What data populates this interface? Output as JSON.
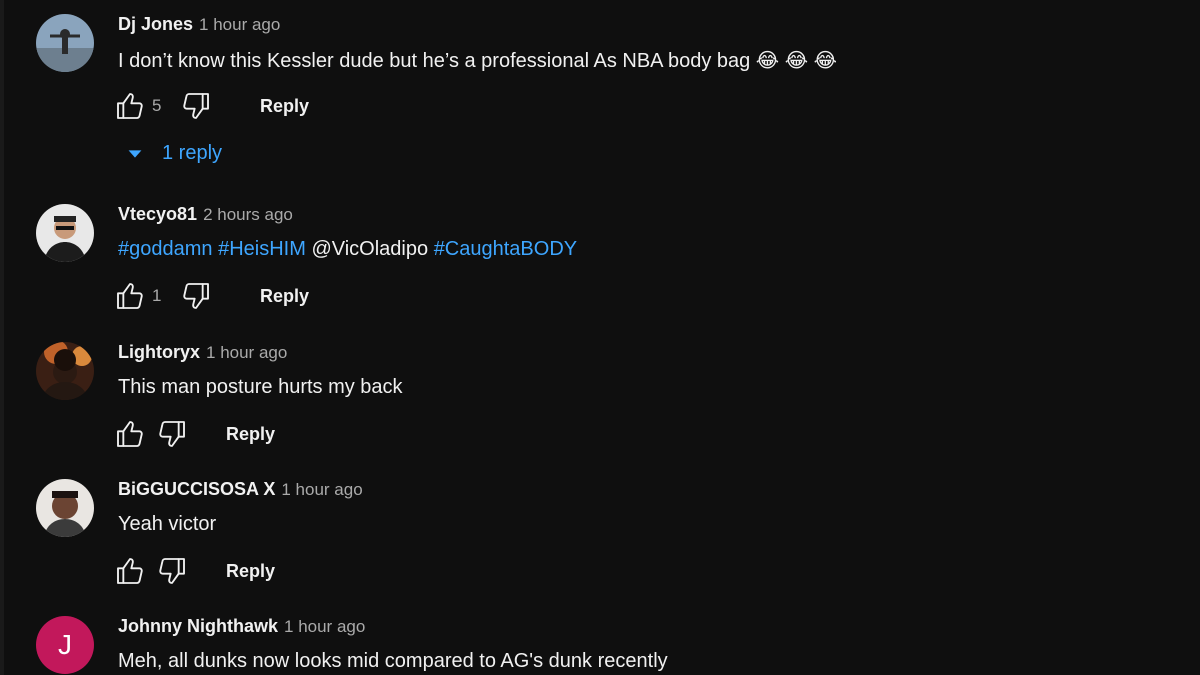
{
  "comments": [
    {
      "author": "Dj Jones",
      "time": "1 hour ago",
      "text": "I don’t know this Kessler dude but he’s a professional As NBA body bag 😂 😂 😂",
      "likes": "5",
      "reply_label": "Reply",
      "replies_label": "1 reply"
    },
    {
      "author": "Vtecyo81",
      "time": "2 hours ago",
      "text_parts": [
        "#goddamn",
        "#HeisHIM",
        "@VicOladipo",
        "#CaughtaBODY"
      ],
      "likes": "1",
      "reply_label": "Reply"
    },
    {
      "author": "Lightoryx",
      "time": "1 hour ago",
      "text": "This man posture hurts my back",
      "reply_label": "Reply"
    },
    {
      "author": "BiGGUCCISOSA X",
      "time": "1 hour ago",
      "text": "Yeah victor",
      "reply_label": "Reply"
    },
    {
      "author": "Johnny Nighthawk",
      "time": "1 hour ago",
      "avatar_letter": "J",
      "text": "Meh, all dunks now looks mid compared to AG's dunk recently"
    }
  ],
  "icons": {
    "like": "thumbs-up-icon",
    "dislike": "thumbs-down-icon",
    "expand": "caret-down-icon"
  },
  "colors": {
    "background": "#0f0f0f",
    "link": "#3ea6ff",
    "secondary_text": "#aaaaaa",
    "letter_avatar": "#c2185b"
  }
}
